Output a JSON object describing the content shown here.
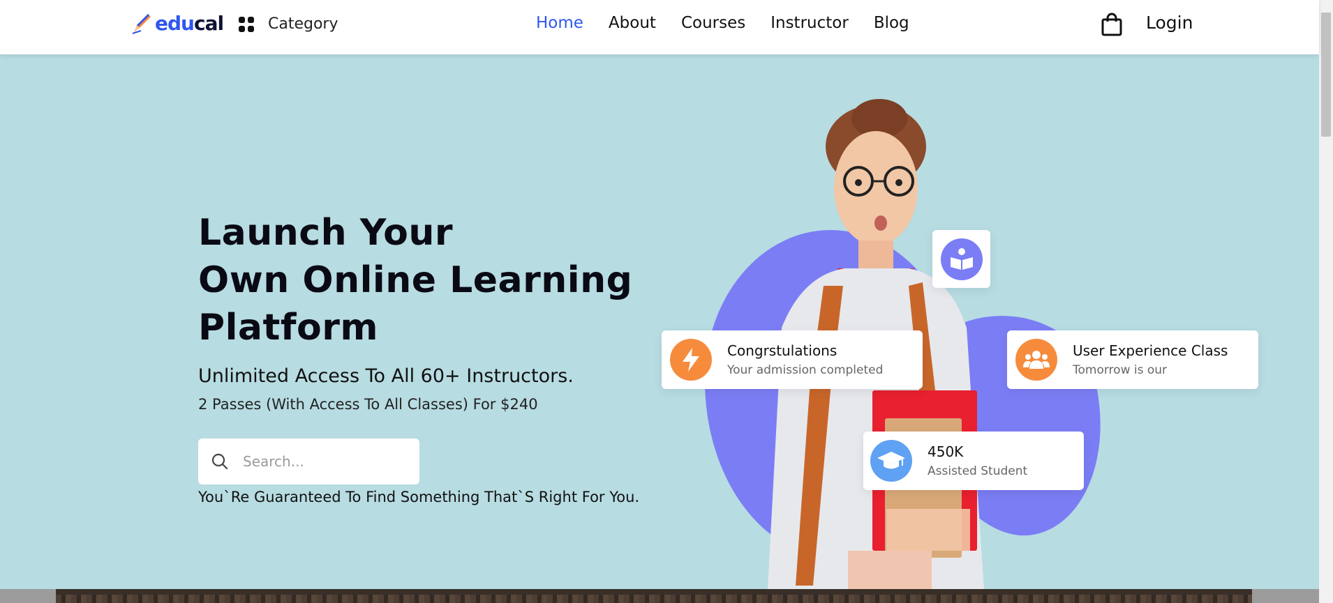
{
  "header": {
    "logo_edu": "edu",
    "logo_cal": "cal",
    "category_label": "Category",
    "nav": [
      {
        "label": "Home",
        "active": true
      },
      {
        "label": "About"
      },
      {
        "label": "Courses"
      },
      {
        "label": "Instructor"
      },
      {
        "label": "Blog"
      }
    ],
    "login_label": "Login"
  },
  "hero": {
    "title_line1": "Launch Your",
    "title_line2": "Own Online Learning",
    "title_line3": "Platform",
    "subtitle": "Unlimited Access To All 60+ Instructors.",
    "passes": "2 Passes (With Access To All Classes) For $240",
    "search_placeholder": "Search...",
    "guarantee": "You`Re Guaranteed To Find Something That`S Right For You."
  },
  "cards": {
    "congrats": {
      "title": "Congrstulations",
      "subtitle": "Your admission completed"
    },
    "ux_class": {
      "title": "User Experience Class",
      "subtitle": "Tomorrow is our"
    },
    "students": {
      "title": "450K",
      "subtitle": "Assisted Student"
    }
  },
  "colors": {
    "hero_bg": "#b7dce2",
    "accent_blue": "#2f57ef",
    "blob_purple": "#7b7df5",
    "orange": "#f68b3c",
    "sky_blue": "#5fa1f2"
  },
  "icons": [
    "category-grid-icon",
    "shopping-bag-icon",
    "search-icon",
    "book-reader-icon",
    "lightning-icon",
    "users-icon",
    "graduation-cap-icon"
  ]
}
